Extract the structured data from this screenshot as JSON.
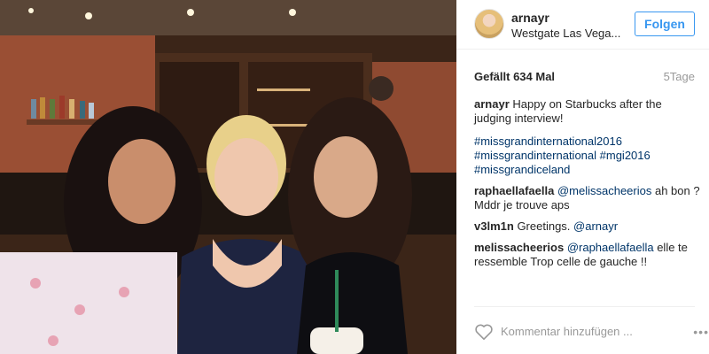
{
  "post": {
    "username": "arnayr",
    "location": "Westgate Las Vega...",
    "follow_label": "Folgen",
    "likes": "Gefällt 634 Mal",
    "time": "5Tage"
  },
  "caption": {
    "user": "arnayr",
    "text": "Happy on Starbucks after the judging interview!",
    "hashtags": [
      "#missgrandinternational2016",
      "#missgrandinternational #mgi2016",
      "#missgrandiceland"
    ]
  },
  "comments": [
    {
      "user": "raphaellafaella",
      "mention": "@melissacheerios",
      "text": "ah bon ? Mddr je trouve aps"
    },
    {
      "user": "v3lm1n",
      "mention": "@arnayr",
      "text": "Greetings."
    },
    {
      "user": "melissacheerios",
      "mention": "@raphaellafaella",
      "text": "elle te ressemble Trop celle de gauche !!"
    }
  ],
  "footer": {
    "comment_placeholder": "Kommentar hinzufügen ...",
    "more": "•••"
  },
  "icons": {
    "like": "heart-icon",
    "more": "more-options-icon",
    "avatar": "avatar"
  },
  "colors": {
    "follow": "#3897f0",
    "link": "#003569",
    "muted": "#999999"
  }
}
